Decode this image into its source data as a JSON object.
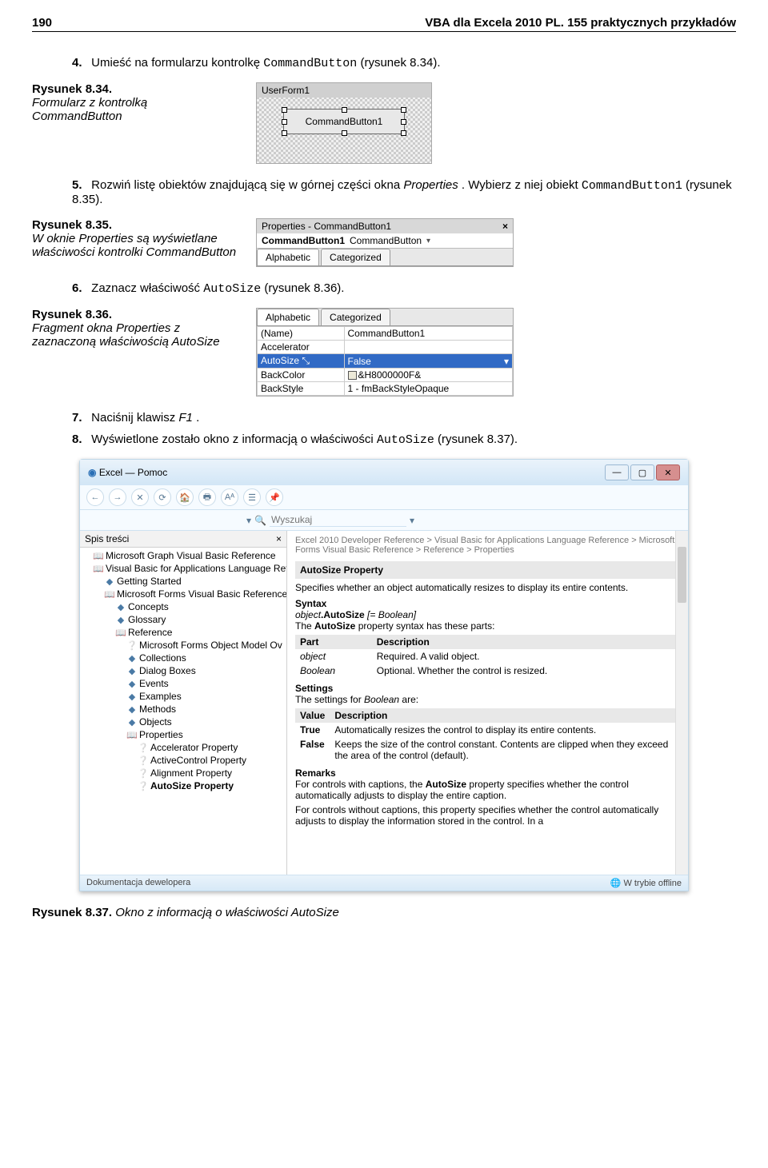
{
  "page": {
    "number": "190",
    "title": "VBA dla Excela 2010 PL. 155 praktycznych przykładów"
  },
  "step4": {
    "num": "4.",
    "text_pre": "Umieść na formularzu kontrolkę ",
    "code": "CommandButton",
    "text_post": " (rysunek 8.34)."
  },
  "fig834": {
    "title": "Rysunek 8.34.",
    "desc": "Formularz z kontrolką CommandButton",
    "userform_title": "UserForm1",
    "button_label": "CommandButton1"
  },
  "step5": {
    "num": "5.",
    "text_pre": "Rozwiń listę obiektów znajdującą się w górnej części okna ",
    "italic1": "Properties",
    "text_mid": ". Wybierz z niej obiekt ",
    "code": "CommandButton1",
    "text_post": " (rysunek 8.35)."
  },
  "fig835": {
    "title": "Rysunek 8.35.",
    "desc": "W oknie Properties są wyświetlane właściwości kontrolki CommandButton",
    "props_title": "Properties - CommandButton1",
    "combo_name": "CommandButton1",
    "combo_type": "CommandButton",
    "tab_alpha": "Alphabetic",
    "tab_cat": "Categorized"
  },
  "step6": {
    "num": "6.",
    "text_pre": "Zaznacz właściwość ",
    "code": "AutoSize",
    "text_post": " (rysunek 8.36)."
  },
  "fig836": {
    "title": "Rysunek 8.36.",
    "desc": "Fragment okna Properties z zaznaczoną właściwością AutoSize",
    "tab_alpha": "Alphabetic",
    "tab_cat": "Categorized",
    "rows": [
      {
        "name": "(Name)",
        "value": "CommandButton1"
      },
      {
        "name": "Accelerator",
        "value": ""
      },
      {
        "name": "AutoSize",
        "value": "False",
        "selected": true
      },
      {
        "name": "BackColor",
        "value": "&H8000000F&",
        "swatch": true
      },
      {
        "name": "BackStyle",
        "value": "1 - fmBackStyleOpaque"
      }
    ]
  },
  "step7": {
    "num": "7.",
    "text_pre": "Naciśnij klawisz ",
    "italic": "F1",
    "text_post": "."
  },
  "step8": {
    "num": "8.",
    "text_pre": "Wyświetlone zostało okno z informacją o właściwości ",
    "code": "AutoSize",
    "text_post": " (rysunek 8.37)."
  },
  "help": {
    "title_left": "Excel — Pomoc",
    "search_placeholder": "Wyszukaj",
    "toc_title": "Spis treści",
    "toc_items": [
      {
        "icon": "book",
        "indent": 0,
        "label": "Microsoft Graph Visual Basic Reference"
      },
      {
        "icon": "book",
        "indent": 0,
        "label": "Visual Basic for Applications Language Refere"
      },
      {
        "icon": "page",
        "indent": 1,
        "label": "Getting Started"
      },
      {
        "icon": "book",
        "indent": 1,
        "label": "Microsoft Forms Visual Basic Reference"
      },
      {
        "icon": "page",
        "indent": 2,
        "label": "Concepts"
      },
      {
        "icon": "page",
        "indent": 2,
        "label": "Glossary"
      },
      {
        "icon": "book",
        "indent": 2,
        "label": "Reference"
      },
      {
        "icon": "q",
        "indent": 3,
        "label": "Microsoft Forms Object Model Ov"
      },
      {
        "icon": "page",
        "indent": 3,
        "label": "Collections"
      },
      {
        "icon": "page",
        "indent": 3,
        "label": "Dialog Boxes"
      },
      {
        "icon": "page",
        "indent": 3,
        "label": "Events"
      },
      {
        "icon": "page",
        "indent": 3,
        "label": "Examples"
      },
      {
        "icon": "page",
        "indent": 3,
        "label": "Methods"
      },
      {
        "icon": "page",
        "indent": 3,
        "label": "Objects"
      },
      {
        "icon": "book",
        "indent": 3,
        "label": "Properties"
      },
      {
        "icon": "q",
        "indent": 4,
        "label": "Accelerator Property"
      },
      {
        "icon": "q",
        "indent": 4,
        "label": "ActiveControl Property"
      },
      {
        "icon": "q",
        "indent": 4,
        "label": "Alignment Property"
      },
      {
        "icon": "q",
        "indent": 4,
        "label": "AutoSize Property",
        "bold": true
      }
    ],
    "breadcrumb": "Excel 2010 Developer Reference > Visual Basic for Applications Language Reference > Microsoft Forms Visual Basic Reference > Reference > Properties",
    "prop_title": "AutoSize Property",
    "description": "Specifies whether an object automatically resizes to display its entire contents.",
    "syntax_label": "Syntax",
    "syntax_line_pre": "object",
    "syntax_line_bold": ".AutoSize",
    "syntax_line_post": " [= Boolean]",
    "parts_intro_pre": "The ",
    "parts_intro_bold": "AutoSize",
    "parts_intro_post": " property syntax has these parts:",
    "parts_table": {
      "head_part": "Part",
      "head_desc": "Description",
      "rows": [
        {
          "part": "object",
          "desc": "Required. A valid object."
        },
        {
          "part": "Boolean",
          "desc": "Optional. Whether the control is resized."
        }
      ]
    },
    "settings_label": "Settings",
    "settings_intro_pre": "The settings for ",
    "settings_intro_it": "Boolean",
    "settings_intro_post": " are:",
    "settings_table": {
      "head_val": "Value",
      "head_desc": "Description",
      "rows": [
        {
          "val": "True",
          "desc": "Automatically resizes the control to display its entire contents."
        },
        {
          "val": "False",
          "desc": "Keeps the size of the control constant. Contents are clipped when they exceed the area of the control (default)."
        }
      ]
    },
    "remarks_label": "Remarks",
    "remarks1_pre": "For controls with captions, the ",
    "remarks1_bold": "AutoSize",
    "remarks1_post": " property specifies whether the control automatically adjusts to display the entire caption.",
    "remarks2": "For controls without captions, this property specifies whether the control automatically adjusts to display the information stored in the control. In a",
    "status_left": "Dokumentacja dewelopera",
    "status_right": "W trybie offline"
  },
  "fig837": {
    "title": "Rysunek 8.37.",
    "desc": "Okno z informacją o właściwości AutoSize"
  }
}
